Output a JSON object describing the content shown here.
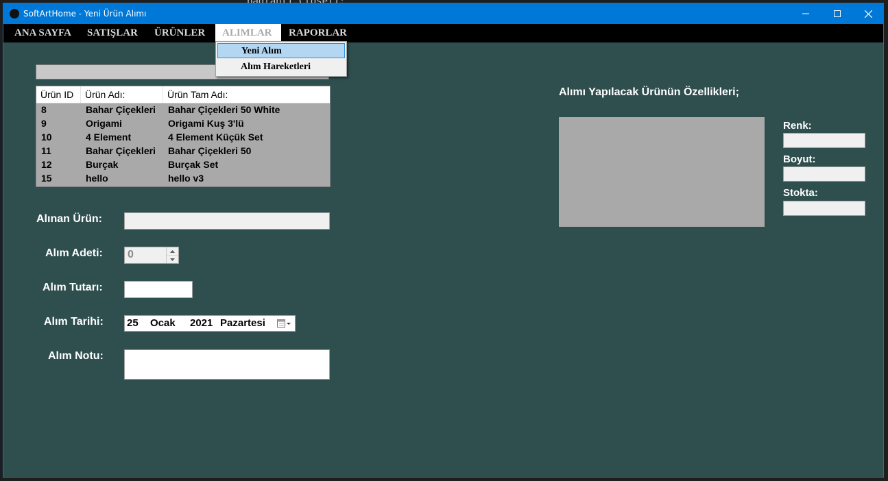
{
  "background": {
    "code_text": "bağlantı.Close();"
  },
  "window": {
    "title": "SoftArtHome - Yeni Ürün Alımı",
    "controls": {
      "minimize": "minimize-icon",
      "maximize": "maximize-icon",
      "close": "close-icon"
    }
  },
  "menu": {
    "items": [
      "ANA SAYFA",
      "SATIŞLAR",
      "ÜRÜNLER",
      "ALIMLAR",
      "RAPORLAR"
    ],
    "active": "ALIMLAR",
    "dropdown": [
      "Yeni Alım",
      "Alım Hareketleri"
    ],
    "dropdown_highlighted": "Yeni Alım"
  },
  "search": {
    "value": ""
  },
  "product_list": {
    "columns": [
      "Ürün ID",
      "Ürün Adı:",
      "Ürün Tam Adı:"
    ],
    "rows": [
      {
        "id": "8",
        "name": "Bahar Çiçekleri",
        "full_name": "Bahar Çiçekleri 50 White"
      },
      {
        "id": "9",
        "name": "Origami",
        "full_name": "Origami Kuş 3'lü"
      },
      {
        "id": "10",
        "name": "4 Element",
        "full_name": "4 Element Küçük Set"
      },
      {
        "id": "11",
        "name": "Bahar Çiçekleri",
        "full_name": "Bahar Çiçekleri 50"
      },
      {
        "id": "12",
        "name": "Burçak",
        "full_name": "Burçak Set"
      },
      {
        "id": "15",
        "name": "hello",
        "full_name": "hello v3"
      }
    ]
  },
  "form": {
    "product_label": "Alınan Ürün:",
    "product_value": "",
    "quantity_label": "Alım Adeti:",
    "quantity_value": "0",
    "amount_label": "Alım Tutarı:",
    "amount_value": "",
    "date_label": "Alım Tarihi:",
    "date_day": "25",
    "date_month": "Ocak",
    "date_year": "2021",
    "date_weekday": "Pazartesi",
    "note_label": "Alım Notu:",
    "note_value": ""
  },
  "details": {
    "heading": "Alımı Yapılacak Ürünün Özellikleri;",
    "color_label": "Renk:",
    "color_value": "",
    "size_label": "Boyut:",
    "size_value": "",
    "stock_label": "Stokta:",
    "stock_value": ""
  },
  "colors": {
    "form_bg": "#2f4f4f",
    "titlebar": "#0078d7",
    "menubar": "#000000",
    "list_bg": "#a9a9a9"
  }
}
